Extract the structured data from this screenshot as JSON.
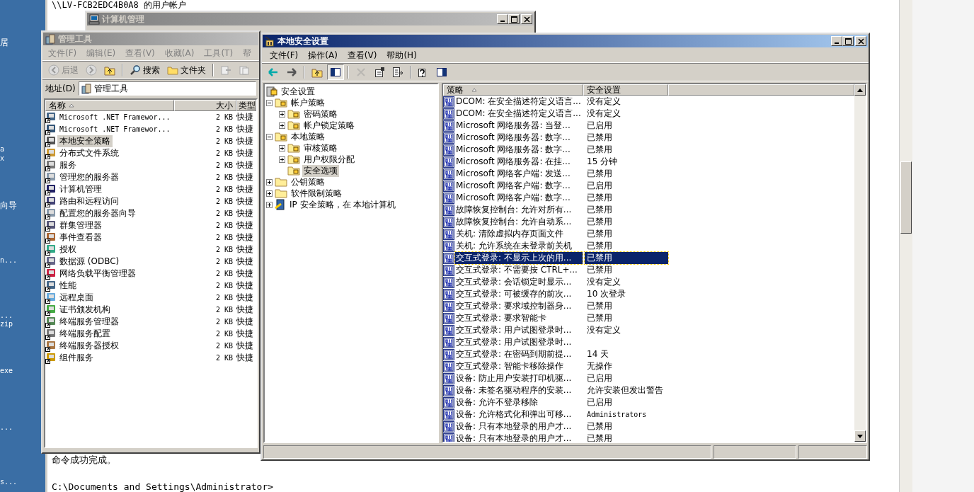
{
  "desktop": {
    "icon_labels": [
      "居",
      "a",
      "x",
      "向导",
      "n...",
      "...",
      "zip",
      "exe",
      "...",
      "s..."
    ]
  },
  "console": {
    "top_line": "\\\\LV-FCB2EDC4B0A8 的用户帐户",
    "lines_bottom": [
      "命令成功完成。",
      "C:\\Documents and Settings\\Administrator>"
    ]
  },
  "computer_management": {
    "title": "计算机管理",
    "active": false
  },
  "admin_tools": {
    "title": "管理工具",
    "active": false,
    "menu": [
      "文件(F)",
      "编辑(E)",
      "查看(V)",
      "收藏(A)",
      "工具(T)",
      "帮"
    ],
    "toolbar": [
      {
        "kind": "back",
        "label": "后退"
      },
      {
        "kind": "forward"
      },
      {
        "kind": "up"
      },
      {
        "kind": "search",
        "label": "搜索"
      },
      {
        "kind": "folders",
        "label": "文件夹"
      },
      {
        "kind": "move"
      },
      {
        "kind": "copy"
      }
    ],
    "address": {
      "label": "地址(D)",
      "value": "管理工具"
    },
    "columns": [
      "名称",
      "大小",
      "类型"
    ],
    "rows": [
      {
        "name": "Microsoft .NET Framewor...",
        "size": "2 KB",
        "type": "快捷",
        "selected": false
      },
      {
        "name": "Microsoft .NET Framewor...",
        "size": "2 KB",
        "type": "快捷",
        "selected": false
      },
      {
        "name": "本地安全策略",
        "size": "2 KB",
        "type": "快捷",
        "selected": true
      },
      {
        "name": "分布式文件系统",
        "size": "2 KB",
        "type": "快捷",
        "selected": false
      },
      {
        "name": "服务",
        "size": "2 KB",
        "type": "快捷",
        "selected": false
      },
      {
        "name": "管理您的服务器",
        "size": "2 KB",
        "type": "快捷",
        "selected": false
      },
      {
        "name": "计算机管理",
        "size": "2 KB",
        "type": "快捷",
        "selected": false
      },
      {
        "name": "路由和远程访问",
        "size": "2 KB",
        "type": "快捷",
        "selected": false
      },
      {
        "name": "配置您的服务器向导",
        "size": "2 KB",
        "type": "快捷",
        "selected": false
      },
      {
        "name": "群集管理器",
        "size": "2 KB",
        "type": "快捷",
        "selected": false
      },
      {
        "name": "事件查看器",
        "size": "2 KB",
        "type": "快捷",
        "selected": false
      },
      {
        "name": "授权",
        "size": "2 KB",
        "type": "快捷",
        "selected": false
      },
      {
        "name": "数据源 (ODBC)",
        "size": "2 KB",
        "type": "快捷",
        "selected": false
      },
      {
        "name": "网络负载平衡管理器",
        "size": "2 KB",
        "type": "快捷",
        "selected": false
      },
      {
        "name": "性能",
        "size": "2 KB",
        "type": "快捷",
        "selected": false
      },
      {
        "name": "远程桌面",
        "size": "2 KB",
        "type": "快捷",
        "selected": false
      },
      {
        "name": "证书颁发机构",
        "size": "2 KB",
        "type": "快捷",
        "selected": false
      },
      {
        "name": "终端服务管理器",
        "size": "2 KB",
        "type": "快捷",
        "selected": false
      },
      {
        "name": "终端服务配置",
        "size": "2 KB",
        "type": "快捷",
        "selected": false
      },
      {
        "name": "终端服务器授权",
        "size": "2 KB",
        "type": "快捷",
        "selected": false
      },
      {
        "name": "组件服务",
        "size": "2 KB",
        "type": "快捷",
        "selected": false
      }
    ]
  },
  "local_security": {
    "title": "本地安全设置",
    "active": true,
    "menu": [
      "文件(F)",
      "操作(A)",
      "查看(V)",
      "帮助(H)"
    ],
    "toolbar": [
      {
        "kind": "back",
        "disabled": false
      },
      {
        "kind": "forward",
        "disabled": false
      },
      {
        "kind": "up",
        "disabled": false
      },
      {
        "kind": "tree",
        "pressed": true
      },
      {
        "kind": "delete",
        "disabled": true
      },
      {
        "kind": "properties",
        "disabled": false
      },
      {
        "kind": "export",
        "disabled": false
      },
      {
        "kind": "help",
        "disabled": false
      },
      {
        "kind": "pane",
        "disabled": false
      }
    ],
    "tree": [
      {
        "label": "安全设置",
        "kind": "root",
        "children": [
          {
            "label": "帐户策略",
            "expanded": true,
            "children": [
              {
                "label": "密码策略",
                "expanded": false,
                "selected": false
              },
              {
                "label": "帐户锁定策略",
                "expanded": false,
                "selected": false
              }
            ],
            "selected": false
          },
          {
            "label": "本地策略",
            "expanded": true,
            "children": [
              {
                "label": "审核策略",
                "expanded": false,
                "selected": false
              },
              {
                "label": "用户权限分配",
                "expanded": false,
                "selected": false
              },
              {
                "label": "安全选项",
                "selected": true
              }
            ],
            "selected": false
          },
          {
            "label": "公钥策略",
            "expanded": false,
            "kind": "plain",
            "selected": false
          },
          {
            "label": "软件限制策略",
            "expanded": false,
            "kind": "plain",
            "selected": false
          },
          {
            "label": "IP 安全策略，在 本地计算机",
            "expanded": false,
            "kind": "ip",
            "selected": false
          }
        ],
        "selected": false
      }
    ],
    "columns": [
      "策略",
      "安全设置"
    ],
    "rows": [
      {
        "policy": "DCOM: 在安全描述符定义语言...",
        "setting": "没有定义",
        "selected": false
      },
      {
        "policy": "DCOM: 在安全描述符定义语言...",
        "setting": "没有定义",
        "selected": false
      },
      {
        "policy": "Microsoft 网络服务器: 当登...",
        "setting": "已启用",
        "selected": false
      },
      {
        "policy": "Microsoft 网络服务器: 数字...",
        "setting": "已禁用",
        "selected": false
      },
      {
        "policy": "Microsoft 网络服务器: 数字...",
        "setting": "已禁用",
        "selected": false
      },
      {
        "policy": "Microsoft 网络服务器: 在挂...",
        "setting": "15 分钟",
        "selected": false
      },
      {
        "policy": "Microsoft 网络客户端: 发送...",
        "setting": "已禁用",
        "selected": false
      },
      {
        "policy": "Microsoft 网络客户端: 数字...",
        "setting": "已启用",
        "selected": false
      },
      {
        "policy": "Microsoft 网络客户端: 数字...",
        "setting": "已禁用",
        "selected": false
      },
      {
        "policy": "故障恢复控制台: 允许对所有...",
        "setting": "已禁用",
        "selected": false
      },
      {
        "policy": "故障恢复控制台: 允许自动系...",
        "setting": "已禁用",
        "selected": false
      },
      {
        "policy": "关机: 清除虚拟内存页面文件",
        "setting": "已禁用",
        "selected": false
      },
      {
        "policy": "关机: 允许系统在未登录前关机",
        "setting": "已禁用",
        "selected": false
      },
      {
        "policy": "交互式登录: 不显示上次的用...",
        "setting": "已禁用",
        "selected": true
      },
      {
        "policy": "交互式登录: 不需要按 CTRL+...",
        "setting": "已禁用",
        "selected": false
      },
      {
        "policy": "交互式登录: 会话锁定时显示...",
        "setting": "没有定义",
        "selected": false
      },
      {
        "policy": "交互式登录: 可被缓存的前次...",
        "setting": "10 次登录",
        "selected": false
      },
      {
        "policy": "交互式登录: 要求域控制器身...",
        "setting": "已禁用",
        "selected": false
      },
      {
        "policy": "交互式登录: 要求智能卡",
        "setting": "已禁用",
        "selected": false
      },
      {
        "policy": "交互式登录: 用户试图登录时...",
        "setting": "没有定义",
        "selected": false
      },
      {
        "policy": "交互式登录: 用户试图登录时...",
        "selected": false
      },
      {
        "policy": "交互式登录: 在密码到期前提...",
        "setting": "14 天",
        "selected": false
      },
      {
        "policy": "交互式登录: 智能卡移除操作",
        "setting": "无操作",
        "selected": false
      },
      {
        "policy": "设备: 防止用户安装打印机驱...",
        "setting": "已启用",
        "selected": false
      },
      {
        "policy": "设备: 未签名驱动程序的安装...",
        "setting": "允许安装但发出警告",
        "selected": false
      },
      {
        "policy": "设备: 允许不登录移除",
        "setting": "已启用",
        "selected": false
      },
      {
        "policy": "设备: 允许格式化和弹出可移...",
        "setting": "Administrators",
        "selected": false
      },
      {
        "policy": "设备: 只有本地登录的用户才...",
        "setting": "已禁用",
        "selected": false
      },
      {
        "policy": "设备: 只有本地登录的用户才...",
        "setting": "已禁用",
        "selected": false
      }
    ]
  }
}
